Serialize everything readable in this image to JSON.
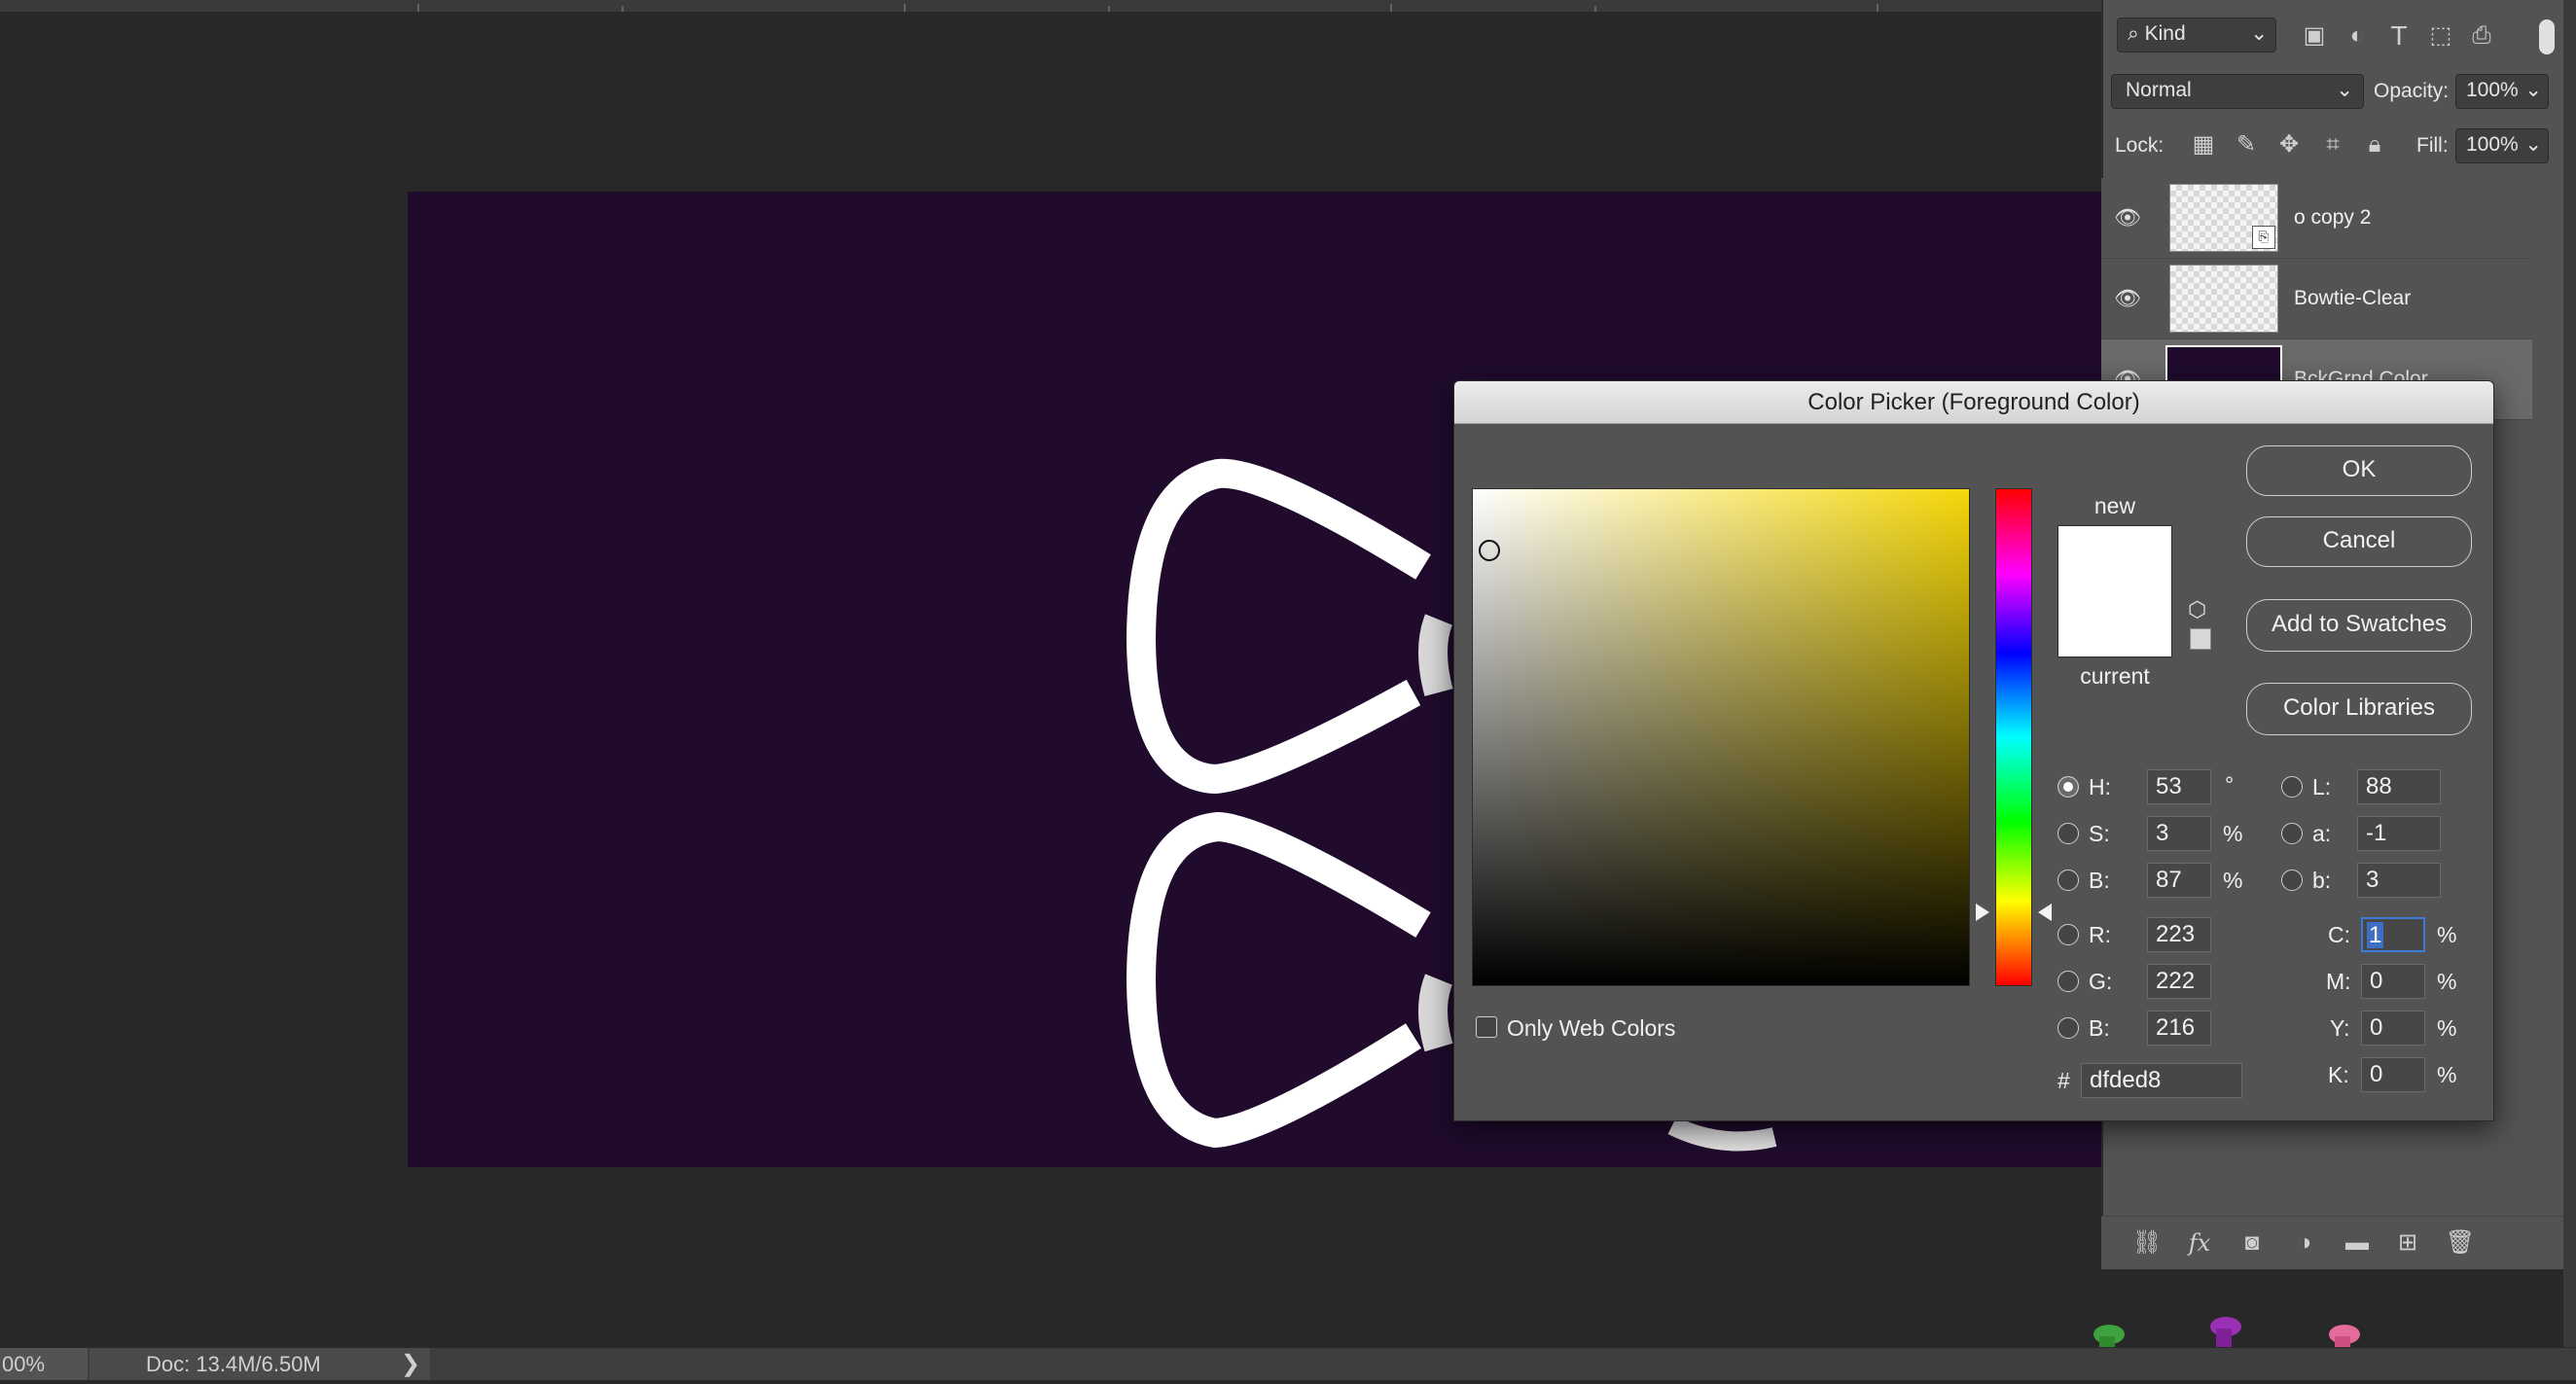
{
  "status": {
    "zoom": "00%",
    "doc": "Doc: 13.4M/6.50M",
    "arrow": "❯"
  },
  "layers_panel": {
    "kind_filter": "Kind",
    "blend_mode": "Normal",
    "opacity_label": "Opacity:",
    "opacity_value": "100%",
    "lock_label": "Lock:",
    "fill_label": "Fill:",
    "fill_value": "100%",
    "layers": [
      {
        "name": "o copy 2"
      },
      {
        "name": "Bowtie-Clear"
      },
      {
        "name": "BckGrnd Color"
      }
    ]
  },
  "dialog": {
    "title": "Color Picker (Foreground Color)",
    "ok": "OK",
    "cancel": "Cancel",
    "add_to_swatches": "Add to Swatches",
    "color_libraries": "Color Libraries",
    "new_label": "new",
    "current_label": "current",
    "only_web_colors": "Only Web Colors",
    "hsb": {
      "h_label": "H:",
      "h": "53",
      "h_unit": "°",
      "s_label": "S:",
      "s": "3",
      "s_unit": "%",
      "b_label": "B:",
      "b": "87",
      "b_unit": "%"
    },
    "rgb": {
      "r_label": "R:",
      "r": "223",
      "g_label": "G:",
      "g": "222",
      "b_label": "B:",
      "b": "216"
    },
    "lab": {
      "l_label": "L:",
      "l": "88",
      "a_label": "a:",
      "a": "-1",
      "b_label": "b:",
      "b": "3"
    },
    "cmyk": {
      "c_label": "C:",
      "c": "1",
      "m_label": "M:",
      "m": "0",
      "y_label": "Y:",
      "y": "0",
      "k_label": "K:",
      "k": "0",
      "unit": "%"
    },
    "hex_label": "#",
    "hex": "dfded8",
    "colors": {
      "new": "#ffffff",
      "current": "#ffffff",
      "field_hue": "#f5d70a"
    }
  },
  "canvas": {
    "background": "#200b2d"
  }
}
